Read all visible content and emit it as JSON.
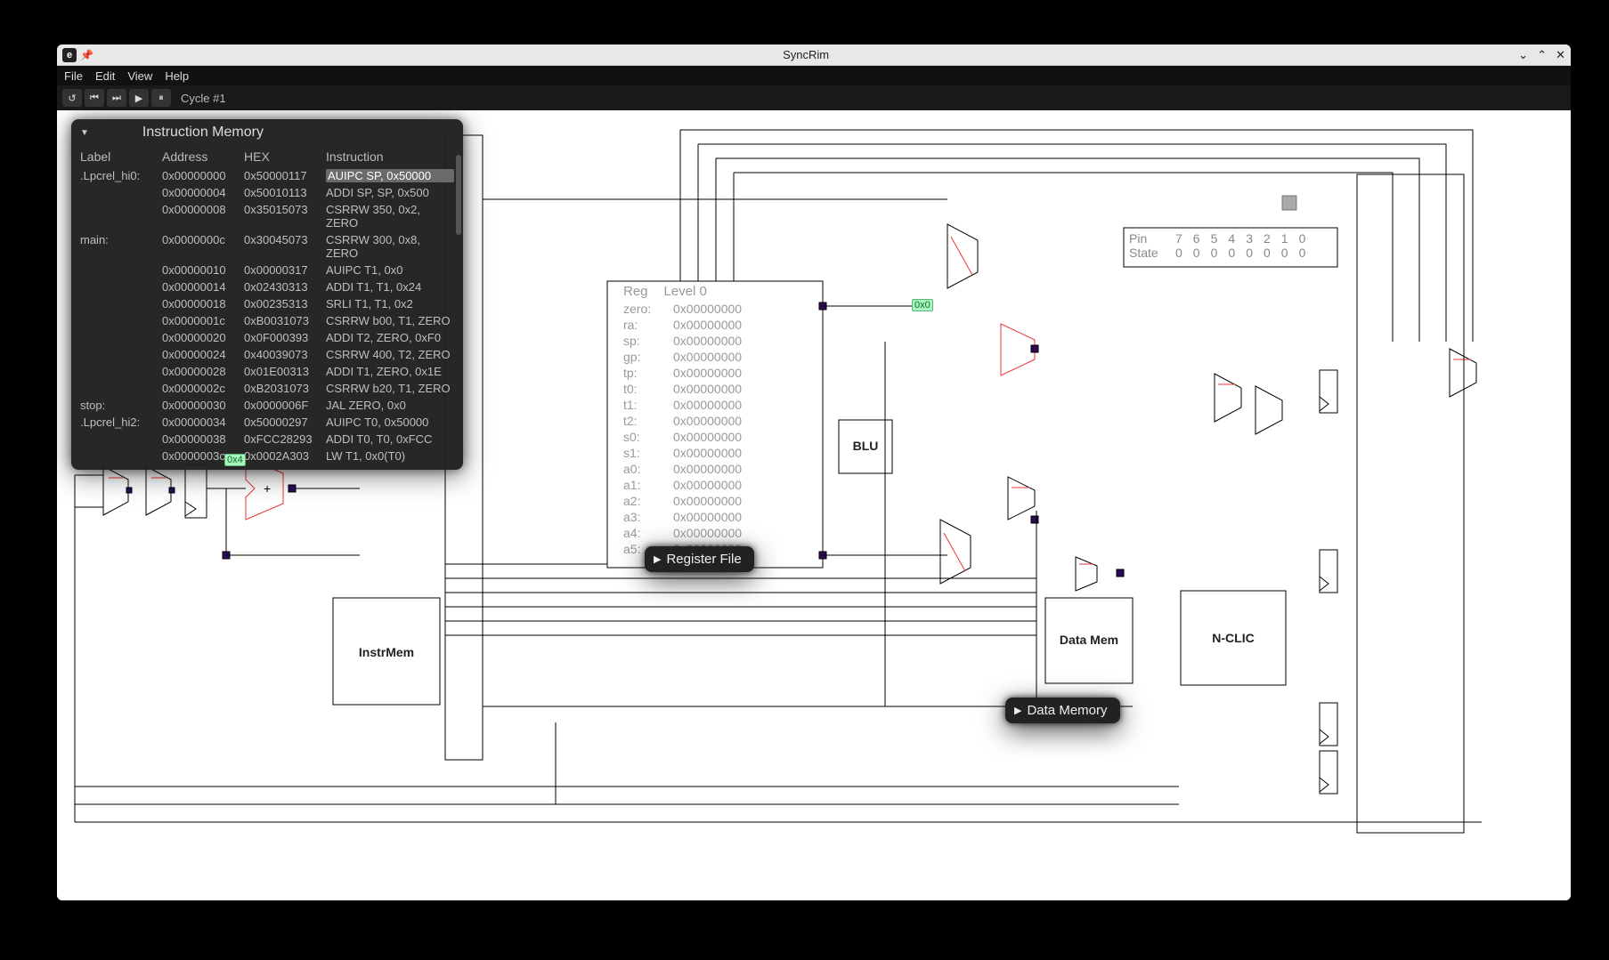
{
  "window": {
    "title": "SyncRim"
  },
  "menubar": [
    "File",
    "Edit",
    "View",
    "Help"
  ],
  "toolbar": {
    "cycle_label": "Cycle #1"
  },
  "imem": {
    "title": "Instruction Memory",
    "cols": [
      "Label",
      "Address",
      "HEX",
      "Instruction"
    ],
    "rows": [
      {
        "label": ".Lpcrel_hi0:",
        "addr": "0x00000000",
        "hex": "0x50000117",
        "instr": "AUIPC SP, 0x50000"
      },
      {
        "label": "",
        "addr": "0x00000004",
        "hex": "0x50010113",
        "instr": "ADDI SP, SP, 0x500"
      },
      {
        "label": "",
        "addr": "0x00000008",
        "hex": "0x35015073",
        "instr": "CSRRW 350, 0x2, ZERO"
      },
      {
        "label": "main:",
        "addr": "0x0000000c",
        "hex": "0x30045073",
        "instr": "CSRRW 300, 0x8, ZERO"
      },
      {
        "label": "",
        "addr": "0x00000010",
        "hex": "0x00000317",
        "instr": "AUIPC T1, 0x0"
      },
      {
        "label": "",
        "addr": "0x00000014",
        "hex": "0x02430313",
        "instr": "ADDI T1, T1, 0x24"
      },
      {
        "label": "",
        "addr": "0x00000018",
        "hex": "0x00235313",
        "instr": "SRLI T1, T1, 0x2"
      },
      {
        "label": "",
        "addr": "0x0000001c",
        "hex": "0xB0031073",
        "instr": "CSRRW b00, T1, ZERO"
      },
      {
        "label": "",
        "addr": "0x00000020",
        "hex": "0x0F000393",
        "instr": "ADDI T2, ZERO, 0xF0"
      },
      {
        "label": "",
        "addr": "0x00000024",
        "hex": "0x40039073",
        "instr": "CSRRW 400, T2, ZERO"
      },
      {
        "label": "",
        "addr": "0x00000028",
        "hex": "0x01E00313",
        "instr": "ADDI T1, ZERO, 0x1E"
      },
      {
        "label": "",
        "addr": "0x0000002c",
        "hex": "0xB2031073",
        "instr": "CSRRW b20, T1, ZERO"
      },
      {
        "label": "stop:",
        "addr": "0x00000030",
        "hex": "0x0000006F",
        "instr": "JAL ZERO, 0x0"
      },
      {
        "label": ".Lpcrel_hi2:",
        "addr": "0x00000034",
        "hex": "0x50000297",
        "instr": "AUIPC T0, 0x50000"
      },
      {
        "label": "",
        "addr": "0x00000038",
        "hex": "0xFCC28293",
        "instr": "ADDI T0, T0, 0xFCC"
      },
      {
        "label": "",
        "addr": "0x0000003c",
        "hex": "0x0002A303",
        "instr": "LW T1, 0x0(T0)"
      }
    ]
  },
  "regs": {
    "hdr": [
      "Reg",
      "Level 0"
    ],
    "rows": [
      [
        "zero:",
        "0x00000000"
      ],
      [
        "ra:",
        "0x00000000"
      ],
      [
        "sp:",
        "0x00000000"
      ],
      [
        "gp:",
        "0x00000000"
      ],
      [
        "tp:",
        "0x00000000"
      ],
      [
        "t0:",
        "0x00000000"
      ],
      [
        "t1:",
        "0x00000000"
      ],
      [
        "t2:",
        "0x00000000"
      ],
      [
        "s0:",
        "0x00000000"
      ],
      [
        "s1:",
        "0x00000000"
      ],
      [
        "a0:",
        "0x00000000"
      ],
      [
        "a1:",
        "0x00000000"
      ],
      [
        "a2:",
        "0x00000000"
      ],
      [
        "a3:",
        "0x00000000"
      ],
      [
        "a4:",
        "0x00000000"
      ],
      [
        "a5:",
        "0x00000000"
      ]
    ]
  },
  "pills": {
    "regfile": "Register File",
    "datamem": "Data Memory"
  },
  "blocks": {
    "instrmem": "InstrMem",
    "blu": "BLU",
    "datamem": "Data Mem",
    "nclic": "N-CLIC"
  },
  "pins": {
    "label_pin": "Pin",
    "label_state": "State",
    "headers": [
      "7",
      "6",
      "5",
      "4",
      "3",
      "2",
      "1",
      "0"
    ],
    "values": [
      "0",
      "0",
      "0",
      "0",
      "0",
      "0",
      "0",
      "0"
    ]
  },
  "tags": {
    "zero_tag_r": "0x0",
    "zero_tag_l": "0x4"
  },
  "adder": {
    "plus": "+"
  }
}
